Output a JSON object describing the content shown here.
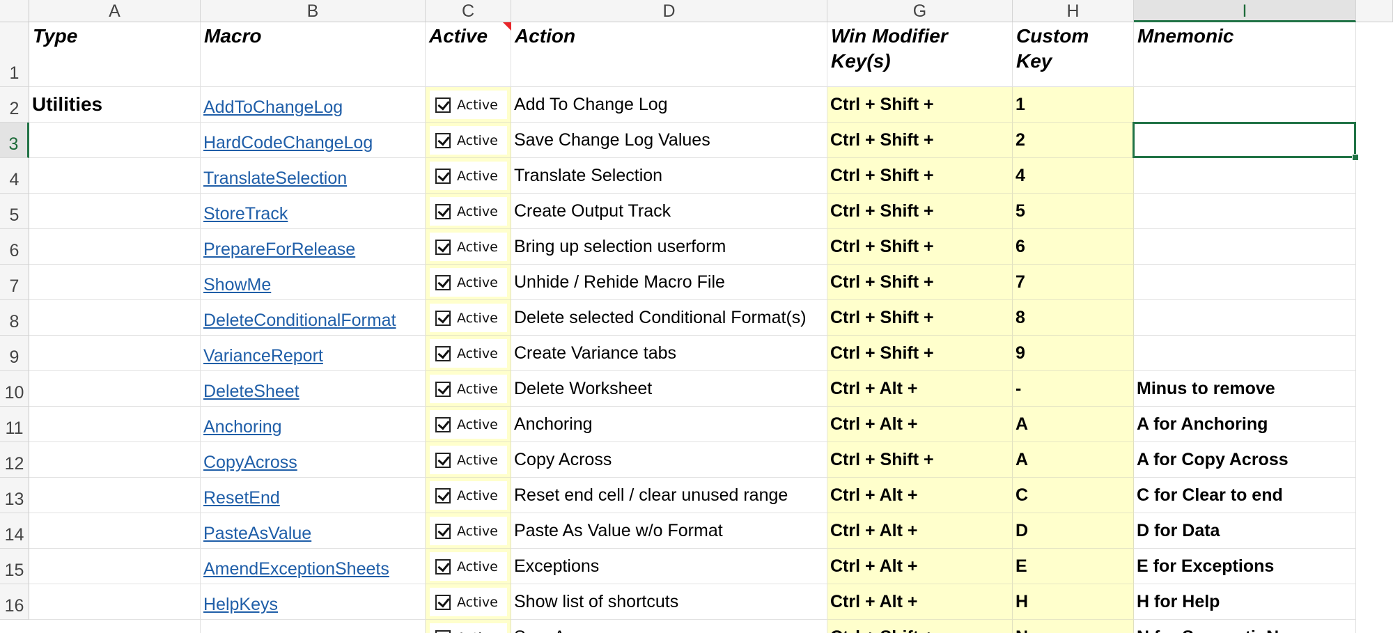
{
  "columns": [
    "A",
    "B",
    "C",
    "D",
    "G",
    "H",
    "I"
  ],
  "selected_column": "I",
  "selected_row": "3",
  "row_numbers": [
    "1",
    "2",
    "3",
    "4",
    "5",
    "6",
    "7",
    "8",
    "9",
    "10",
    "11",
    "12",
    "13",
    "14",
    "15",
    "16"
  ],
  "headers": {
    "type": "Type",
    "macro": "Macro",
    "active": "Active",
    "action": "Action",
    "win_modifier": "Win Modifier Key(s)",
    "custom_key": "Custom Key",
    "mnemonic": "Mnemonic"
  },
  "group_label": "Utilities",
  "checkbox_label": "Active",
  "rows": [
    {
      "macro": "AddToChangeLog",
      "action": "Add To Change Log",
      "modifier": "Ctrl + Shift +",
      "key": "1",
      "mnemonic": ""
    },
    {
      "macro": "HardCodeChangeLog",
      "action": "Save Change Log Values",
      "modifier": "Ctrl + Shift +",
      "key": "2",
      "mnemonic": ""
    },
    {
      "macro": "TranslateSelection",
      "action": "Translate Selection",
      "modifier": "Ctrl + Shift +",
      "key": "4",
      "mnemonic": ""
    },
    {
      "macro": "StoreTrack",
      "action": "Create Output Track",
      "modifier": "Ctrl + Shift +",
      "key": "5",
      "mnemonic": ""
    },
    {
      "macro": "PrepareForRelease",
      "action": "Bring up selection userform",
      "modifier": "Ctrl + Shift +",
      "key": "6",
      "mnemonic": ""
    },
    {
      "macro": "ShowMe",
      "action": "Unhide / Rehide Macro File",
      "modifier": "Ctrl + Shift +",
      "key": "7",
      "mnemonic": ""
    },
    {
      "macro": "DeleteConditionalFormat",
      "action": "Delete selected Conditional Format(s)",
      "modifier": "Ctrl + Shift +",
      "key": "8",
      "mnemonic": ""
    },
    {
      "macro": "VarianceReport",
      "action": "Create Variance tabs",
      "modifier": "Ctrl + Shift +",
      "key": "9",
      "mnemonic": ""
    },
    {
      "macro": "DeleteSheet",
      "action": "Delete Worksheet",
      "modifier": "Ctrl + Alt +",
      "key": "-",
      "mnemonic": "Minus to remove"
    },
    {
      "macro": "Anchoring",
      "action": "Anchoring",
      "modifier": "Ctrl + Alt +",
      "key": "A",
      "mnemonic": "A for Anchoring"
    },
    {
      "macro": "CopyAcross",
      "action": "Copy Across",
      "modifier": "Ctrl + Shift +",
      "key": "A",
      "mnemonic": "A for Copy Across"
    },
    {
      "macro": "ResetEnd",
      "action": "Reset end cell / clear unused range",
      "modifier": "Ctrl + Alt +",
      "key": "C",
      "mnemonic": "C for Clear to end"
    },
    {
      "macro": "PasteAsValue",
      "action": "Paste As Value w/o Format",
      "modifier": "Ctrl + Alt +",
      "key": "D",
      "mnemonic": "D for Data"
    },
    {
      "macro": "AmendExceptionSheets",
      "action": "Exceptions",
      "modifier": "Ctrl + Alt +",
      "key": "E",
      "mnemonic": "E for Exceptions"
    },
    {
      "macro": "HelpKeys",
      "action": "Show list of shortcuts",
      "modifier": "Ctrl + Alt +",
      "key": "H",
      "mnemonic": "H for Help"
    },
    {
      "macro": "",
      "action": "Sum A",
      "modifier": "Ctrl + Shift +",
      "key": "N",
      "mnemonic": "N for SummatioN"
    }
  ]
}
